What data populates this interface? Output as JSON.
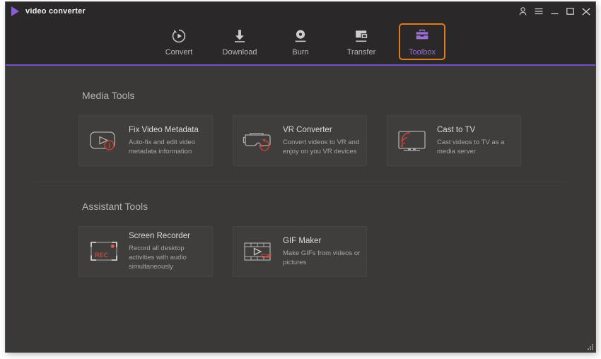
{
  "window": {
    "title": "video converter",
    "logo_icon": "play-triangle-logo",
    "controls": [
      {
        "name": "account-icon",
        "glyph": "person"
      },
      {
        "name": "menu-icon",
        "glyph": "hamburger"
      },
      {
        "name": "minimize-icon",
        "glyph": "minimize"
      },
      {
        "name": "maximize-icon",
        "glyph": "maximize"
      },
      {
        "name": "close-icon",
        "glyph": "close"
      }
    ]
  },
  "colors": {
    "window_bg": "#3b3838",
    "titlebar_bg": "#2a2828",
    "accent_purple": "#7b4fc4",
    "active_tab_border": "#e07b1f",
    "active_tab_text": "#9b6fd6",
    "card_bg": "#403d3d",
    "icon_stroke": "#b0adad",
    "accent_red": "#c9453c"
  },
  "nav": {
    "tabs": [
      {
        "label": "Convert",
        "icon": "convert-icon",
        "active": false
      },
      {
        "label": "Download",
        "icon": "download-icon",
        "active": false
      },
      {
        "label": "Burn",
        "icon": "burn-icon",
        "active": false
      },
      {
        "label": "Transfer",
        "icon": "transfer-icon",
        "active": false
      },
      {
        "label": "Toolbox",
        "icon": "toolbox-icon",
        "active": true
      }
    ]
  },
  "sections": [
    {
      "title": "Media Tools",
      "cards": [
        {
          "title": "Fix Video Metadata",
          "desc": "Auto-fix and edit video metadata information",
          "icon": "fix-video-metadata-icon"
        },
        {
          "title": "VR Converter",
          "desc": "Convert videos to VR and enjoy on you VR devices",
          "icon": "vr-converter-icon"
        },
        {
          "title": "Cast to TV",
          "desc": "Cast videos to TV as a media server",
          "icon": "cast-to-tv-icon"
        }
      ]
    },
    {
      "title": "Assistant Tools",
      "cards": [
        {
          "title": "Screen Recorder",
          "desc": "Record all desktop activities with audio simultaneously",
          "icon": "screen-recorder-icon",
          "badge_text": "REC"
        },
        {
          "title": "GIF Maker",
          "desc": "Make GIFs from videos or pictures",
          "icon": "gif-maker-icon",
          "badge_text": "GIF"
        }
      ]
    }
  ]
}
